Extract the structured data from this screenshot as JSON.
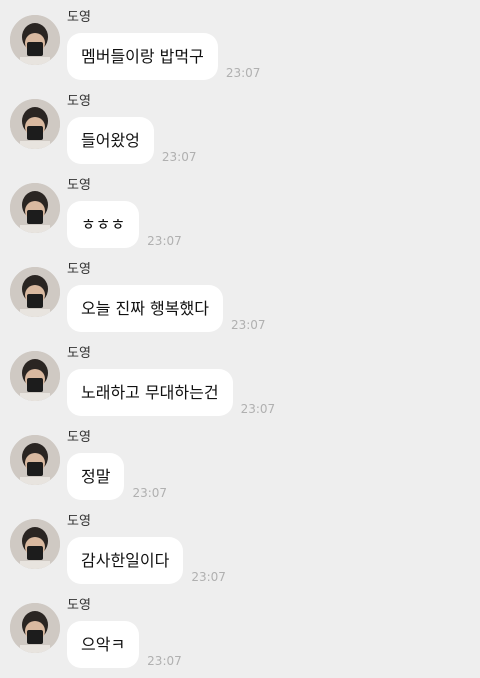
{
  "chat": {
    "messages": [
      {
        "sender": "도영",
        "text": "멤버들이랑 밥먹구",
        "time": "23:07"
      },
      {
        "sender": "도영",
        "text": "들어왔엉",
        "time": "23:07"
      },
      {
        "sender": "도영",
        "text": "ㅎㅎㅎ",
        "time": "23:07"
      },
      {
        "sender": "도영",
        "text": "오늘 진짜 행복했다",
        "time": "23:07"
      },
      {
        "sender": "도영",
        "text": "노래하고 무대하는건",
        "time": "23:07"
      },
      {
        "sender": "도영",
        "text": "정말",
        "time": "23:07"
      },
      {
        "sender": "도영",
        "text": "감사한일이다",
        "time": "23:07"
      },
      {
        "sender": "도영",
        "text": "으악ㅋ",
        "time": "23:07"
      }
    ]
  }
}
